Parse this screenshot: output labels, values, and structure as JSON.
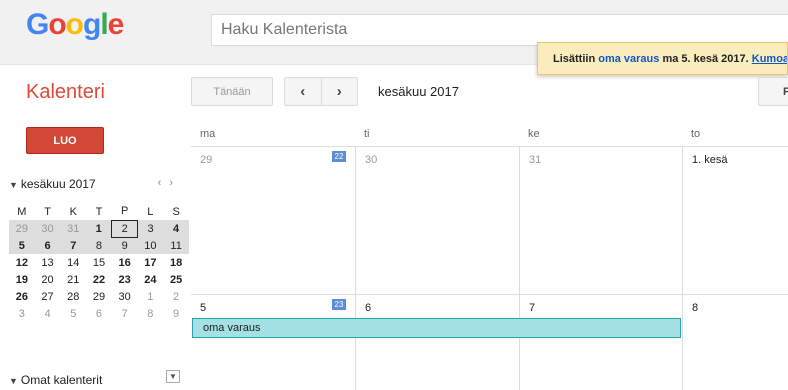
{
  "header": {
    "logo": [
      "G",
      "o",
      "o",
      "g",
      "l",
      "e"
    ],
    "search_placeholder": "Haku Kalenterista"
  },
  "notification": {
    "prefix": "Lisättiin ",
    "event_link": "oma varaus",
    "suffix": " ma 5. kesä 2017. ",
    "undo": "Kumoa"
  },
  "toolbar": {
    "app_title": "Kalenteri",
    "today": "Tänään",
    "prev": "‹",
    "next": "›",
    "date_range": "kesäkuu 2017",
    "right_btn": "P"
  },
  "create_button": "LUO",
  "mini_calendar": {
    "month": "kesäkuu 2017",
    "weekdays": [
      "M",
      "T",
      "K",
      "T",
      "P",
      "L",
      "S"
    ],
    "weeks": [
      [
        "29",
        "30",
        "31",
        "1",
        "2",
        "3",
        "4"
      ],
      [
        "5",
        "6",
        "7",
        "8",
        "9",
        "10",
        "11"
      ],
      [
        "12",
        "13",
        "14",
        "15",
        "16",
        "17",
        "18"
      ],
      [
        "19",
        "20",
        "21",
        "22",
        "23",
        "24",
        "25"
      ],
      [
        "26",
        "27",
        "28",
        "29",
        "30",
        "1",
        "2"
      ],
      [
        "3",
        "4",
        "5",
        "6",
        "7",
        "8",
        "9"
      ]
    ]
  },
  "sidebar": {
    "own_calendars": "Omat kalenterit"
  },
  "main_grid": {
    "days": [
      "ma",
      "ti",
      "ke",
      "to"
    ],
    "week1": {
      "week_number": "22",
      "dates": [
        "29",
        "30",
        "31",
        "1. kesä"
      ]
    },
    "week2": {
      "week_number": "23",
      "dates": [
        "5",
        "6",
        "7",
        "8"
      ]
    },
    "event": "oma varaus"
  },
  "colors": {
    "accent_red": "#dd4b39",
    "create_button": "#d14836",
    "event_bg": "#a4e1e4",
    "event_border": "#2ba3a8",
    "week_badge": "#5a8ed6",
    "notification_bg": "#f9edbe"
  }
}
